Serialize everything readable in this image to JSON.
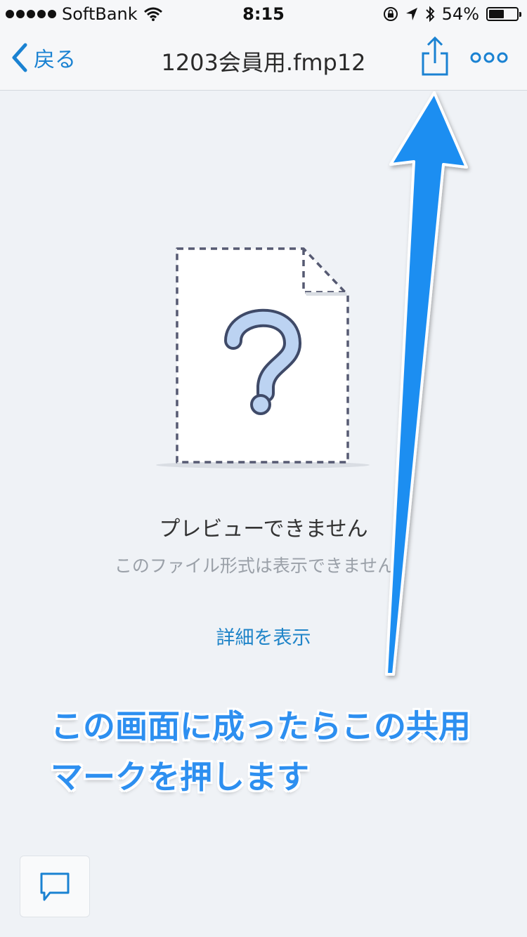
{
  "status_bar": {
    "carrier": "SoftBank",
    "time": "8:15",
    "battery_percent": "54%",
    "battery_level": 0.54,
    "icons": [
      "signal-dots-icon",
      "wifi-icon",
      "orientation-lock-icon",
      "location-arrow-icon",
      "bluetooth-icon",
      "battery-icon"
    ]
  },
  "nav": {
    "back_label": "戻る",
    "title": "1203会員用.fmp12",
    "share_icon": "share-icon",
    "more_icon": "more-dots-icon"
  },
  "preview": {
    "illustration_icon": "unknown-file-question-icon",
    "title": "プレビューできません",
    "subtitle": "このファイル形式は表示できません。",
    "details_link": "詳細を表示"
  },
  "annotation": {
    "line1": "この画面に成ったらこの共用",
    "line2": "マークを押します",
    "color": "#2d8ff0"
  },
  "comment_button": {
    "icon": "comment-bubble-icon"
  },
  "colors": {
    "accent": "#1a82d2",
    "background": "#eff2f6",
    "bar": "#f6f7f9"
  }
}
